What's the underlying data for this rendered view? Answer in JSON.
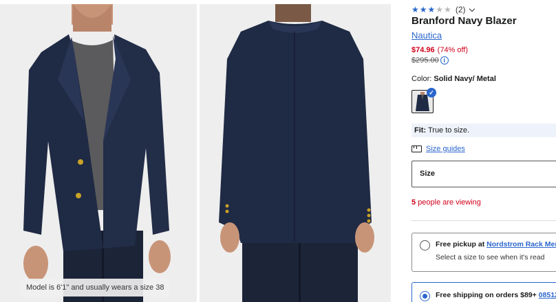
{
  "gallery": {
    "caption": "Model is 6'1\" and usually wears a size 38"
  },
  "product": {
    "rating": 3,
    "rating_max": 5,
    "review_count": "(2)",
    "title": "Branford Navy Blazer",
    "brand": "Nautica",
    "price": "$74.96",
    "discount": "(74% off)",
    "original_price": "$295.00",
    "color_label": "Color:",
    "color_value": "Solid Navy/ Metal",
    "fit_label": "Fit:",
    "fit_value": "True to size.",
    "size_guides": "Size guides",
    "size_select_label": "Size",
    "viewing_count": "5",
    "viewing_text": "people are viewing"
  },
  "shipping_options": {
    "pickup": {
      "prefix": "Free pickup at",
      "store": "Nordstrom Rack Mer",
      "note": "Select a size to see when it's read"
    },
    "shipping": {
      "prefix": "Free shipping on orders $89+",
      "zip": "08512",
      "selected": true
    }
  },
  "colors": {
    "accent": "#2a66cc",
    "sale": "#d0021b",
    "blazer": "#1f2a44",
    "photo_bg": "#eeeeee"
  },
  "icons": [
    "star-icon",
    "chevron-down-icon",
    "info-icon",
    "check-icon",
    "ruler-icon",
    "radio-icon"
  ]
}
